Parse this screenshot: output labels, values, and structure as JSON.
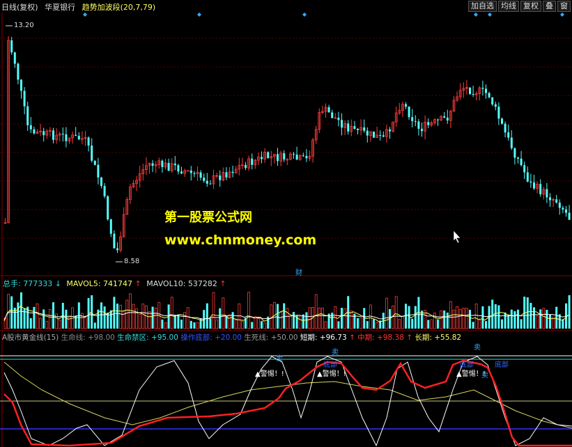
{
  "toolbar": {
    "period": "日线(复权)",
    "stock": "华夏银行",
    "indicator": "趋势加波段(20,7,79)",
    "buttons": [
      "加自选",
      "均线",
      "复权",
      "叠",
      "窗"
    ]
  },
  "price_panel": {
    "high_label": "13.20",
    "low_label": "8.58",
    "finance_marker": "财"
  },
  "volume_panel": {
    "label": "总手: 777333",
    "mavol5": "MAVOL5: 741747",
    "mavol10": "MAVOL10: 537282"
  },
  "gold_panel": {
    "name": "A股市黄金线(15)",
    "life": "生命线: +98.00",
    "ban": "生命禁区: +95.00",
    "bottom": "操作底部: +20.00",
    "death": "生死线: +50.00",
    "short": "短期: +96.73",
    "mid": "中期: +98.38",
    "long": "长期: +55.82",
    "warnings": [
      "▲警惕！!",
      "▲警惕！!",
      "▲警惕！!"
    ],
    "sell_labels": [
      "卖",
      "卖",
      "卖",
      "卖"
    ],
    "bottom_tags": [
      "底部",
      "底部",
      "底部"
    ]
  },
  "watermark": {
    "line1": "第一股票公式网",
    "line2": "www.chnmoney.com"
  },
  "colors": {
    "up": "#ff3b3b",
    "down": "#54ffff",
    "mavol5": "#ffff66",
    "red_line": "#ff2020",
    "white_line": "#ffffff",
    "yellow_line": "#e8e85a"
  }
}
